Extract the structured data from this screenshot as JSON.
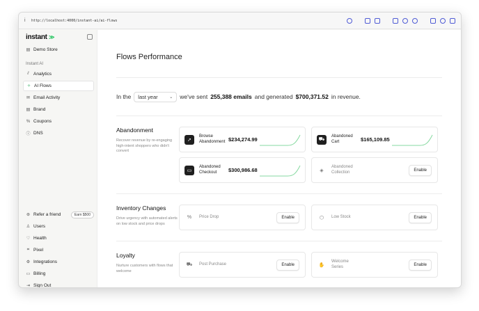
{
  "browser": {
    "info_icon": "i",
    "url": "http://localhost:4000/instant-ai/ai-flows"
  },
  "sidebar": {
    "logo": "instant",
    "logo_mark": "≫",
    "store": "Demo Store",
    "section_label": "Instant AI",
    "items": [
      {
        "label": "Analytics",
        "icon": "chart-icon",
        "glyph": "⫽",
        "active": false
      },
      {
        "label": "AI Flows",
        "icon": "sparkle-icon",
        "glyph": "✧",
        "active": true
      },
      {
        "label": "Email Activity",
        "icon": "mail-icon",
        "glyph": "✉",
        "active": false
      },
      {
        "label": "Brand",
        "icon": "store-icon",
        "glyph": "▤",
        "active": false
      },
      {
        "label": "Coupons",
        "icon": "percent-icon",
        "glyph": "%",
        "active": false
      },
      {
        "label": "DNS",
        "icon": "info-icon",
        "glyph": "ⓘ",
        "active": false
      }
    ],
    "bottom_items": [
      {
        "label": "Refer a friend",
        "icon": "gift-icon",
        "glyph": "⊛",
        "badge": "Earn $500"
      },
      {
        "label": "Users",
        "icon": "user-icon",
        "glyph": "♙"
      },
      {
        "label": "Health",
        "icon": "heart-icon",
        "glyph": "♡"
      },
      {
        "label": "Pixel",
        "icon": "pixel-icon",
        "glyph": "⌗"
      },
      {
        "label": "Integrations",
        "icon": "gear-icon",
        "glyph": "⚙"
      },
      {
        "label": "Billing",
        "icon": "card-icon",
        "glyph": "▭"
      },
      {
        "label": "Sign Out",
        "icon": "logout-icon",
        "glyph": "⇥"
      }
    ]
  },
  "main": {
    "title": "Flows Performance",
    "summary": {
      "prefix": "In the",
      "period": "last year",
      "middle": "we've sent",
      "emails": "255,388 emails",
      "middle2": "and generated",
      "revenue": "$700,371.52",
      "suffix": "in revenue."
    },
    "sections": [
      {
        "title": "Abandonment",
        "description": "Recover revenue by re-engaging high-intent shoppers who didn't convert",
        "cards": [
          {
            "label": "Browse Abandonment",
            "value": "$234,274.99",
            "icon": "cursor-icon",
            "glyph": "➚",
            "enabled": true
          },
          {
            "label": "Abandoned Cart",
            "value": "$165,109.85",
            "icon": "cart-icon",
            "glyph": "⛟",
            "enabled": true
          },
          {
            "label": "Abandoned Checkout",
            "value": "$300,986.68",
            "icon": "checkout-icon",
            "glyph": "▭",
            "enabled": true
          },
          {
            "label": "Abandoned Collection",
            "value": "",
            "icon": "layers-icon",
            "glyph": "◈",
            "enabled": false,
            "action": "Enable"
          }
        ]
      },
      {
        "title": "Inventory Changes",
        "description": "Drive urgency with automated alerts on low stock and price drops",
        "cards": [
          {
            "label": "Price Drop",
            "icon": "percent-icon",
            "glyph": "%",
            "enabled": false,
            "action": "Enable"
          },
          {
            "label": "Low Stock",
            "icon": "box-icon",
            "glyph": "⬡",
            "enabled": false,
            "action": "Enable"
          }
        ]
      },
      {
        "title": "Loyalty",
        "description": "Nurture customers with flows that welcome",
        "cards": [
          {
            "label": "Post Purchase",
            "icon": "truck-icon",
            "glyph": "⛟",
            "enabled": false,
            "action": "Enable"
          },
          {
            "label": "Welcome Series",
            "icon": "hand-icon",
            "glyph": "✋",
            "enabled": false,
            "action": "Enable"
          }
        ]
      }
    ]
  },
  "colors": {
    "accent": "#22c55e",
    "sparkline": "#86d9a0"
  }
}
